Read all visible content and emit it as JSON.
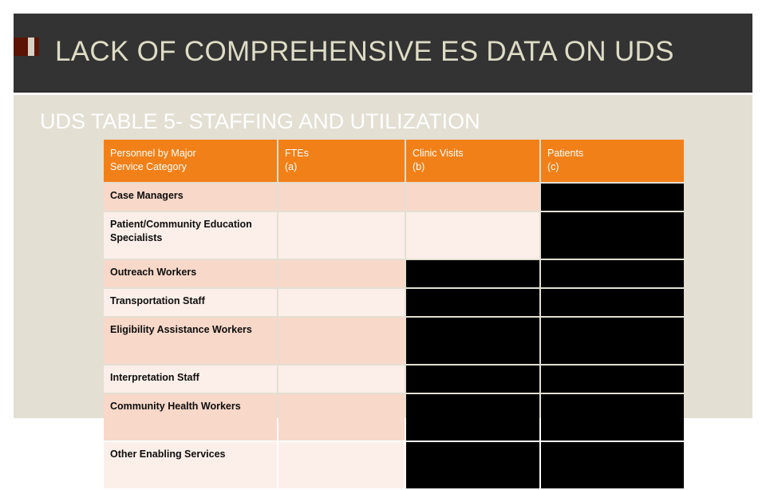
{
  "slide": {
    "title": "LACK OF COMPREHENSIVE ES DATA ON UDS",
    "subtitle": "UDS TABLE 5- STAFFING AND UTILIZATION",
    "colors": {
      "title_band": "#333333",
      "title_text": "#dedcc5",
      "decoration": "#5c1405",
      "decoration_stripe": "#d8d2c4",
      "content_background": "#e3dfd3",
      "subtitle_text": "#ffffff",
      "table_header": "#f28018",
      "row_a": "#f8d8c9",
      "row_b": "#fcefe9",
      "redacted": "#000000"
    }
  },
  "table": {
    "headers": [
      {
        "label": "Personnel by Major",
        "sub": "Service Category"
      },
      {
        "label": "FTEs",
        "sub": "(a)"
      },
      {
        "label": "Clinic Visits",
        "sub": "(b)"
      },
      {
        "label": "Patients",
        "sub": "(c)"
      }
    ],
    "rows": [
      {
        "personnel": "Case Managers",
        "ftes": "",
        "visits": "",
        "patients": "",
        "redacted": [
          "patients"
        ]
      },
      {
        "personnel": "Patient/Community Education Specialists",
        "ftes": "",
        "visits": "",
        "patients": "",
        "redacted": [
          "patients"
        ]
      },
      {
        "personnel": "Outreach Workers",
        "ftes": "",
        "visits": "",
        "patients": "",
        "redacted": [
          "visits",
          "patients"
        ]
      },
      {
        "personnel": "Transportation Staff",
        "ftes": "",
        "visits": "",
        "patients": "",
        "redacted": [
          "visits",
          "patients"
        ]
      },
      {
        "personnel": "Eligibility Assistance Workers",
        "ftes": "",
        "visits": "",
        "patients": "",
        "redacted": [
          "visits",
          "patients"
        ]
      },
      {
        "personnel": "Interpretation Staff",
        "ftes": "",
        "visits": "",
        "patients": "",
        "redacted": [
          "visits",
          "patients"
        ]
      },
      {
        "personnel": "Community Health Workers",
        "ftes": "",
        "visits": "",
        "patients": "",
        "redacted": [
          "visits",
          "patients"
        ]
      },
      {
        "personnel": "Other Enabling Services",
        "ftes": "",
        "visits": "",
        "patients": "",
        "redacted": [
          "visits",
          "patients"
        ]
      }
    ]
  }
}
